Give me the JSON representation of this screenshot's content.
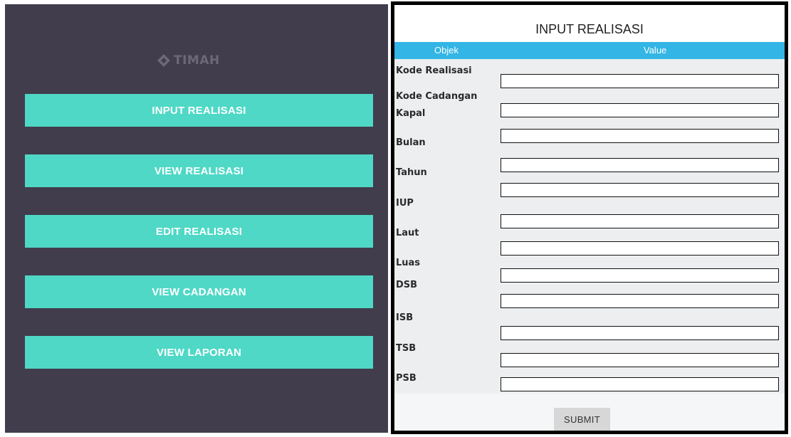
{
  "menu": {
    "logo": {
      "text": "TIMAH",
      "icon": "timah-logo-icon"
    },
    "buttons": [
      {
        "label": "INPUT REALISASI"
      },
      {
        "label": "VIEW REALISASI"
      },
      {
        "label": "EDIT REALISASI"
      },
      {
        "label": "VIEW CADANGAN"
      },
      {
        "label": "VIEW LAPORAN"
      }
    ],
    "colors": {
      "background": "#413d4d",
      "button": "#4fd8c6",
      "button_text": "#ffffff"
    }
  },
  "form": {
    "title": "INPUT REALISASI",
    "columns": {
      "objek": "Objek",
      "value": "Value"
    },
    "fields": [
      {
        "label": "Kode Realisasi",
        "value": ""
      },
      {
        "label": "Kode Cadangan",
        "value": ""
      },
      {
        "label": "Kapal",
        "value": ""
      },
      {
        "label": "Bulan",
        "value": ""
      },
      {
        "label": "Tahun",
        "value": ""
      },
      {
        "label": "IUP",
        "value": ""
      },
      {
        "label": "Laut",
        "value": ""
      },
      {
        "label": "Luas",
        "value": ""
      },
      {
        "label": "DSB",
        "value": ""
      },
      {
        "label": "ISB",
        "value": ""
      },
      {
        "label": "TSB",
        "value": ""
      },
      {
        "label": "PSB",
        "value": ""
      }
    ],
    "submit_label": "SUBMIT",
    "colors": {
      "header_bar": "#33b5e5",
      "submit_button": "#d7d7d7"
    }
  }
}
